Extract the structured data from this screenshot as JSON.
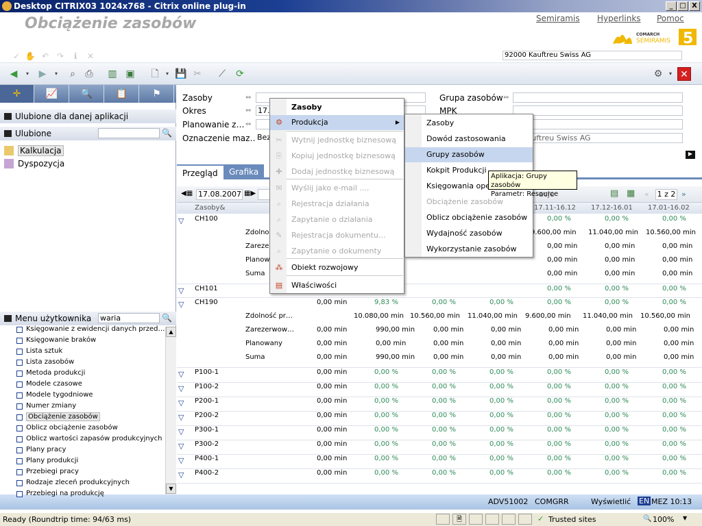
{
  "window": {
    "title": "Desktop CITRIX03 1024x768 - Citrix online plug-in",
    "min": "_",
    "max": "□",
    "close": "X"
  },
  "header": {
    "title": "Obciążenie zasobów",
    "links": [
      "Semiramis",
      "Hyperlinks",
      "Pomoc"
    ],
    "logo": {
      "brand_top": "COMARCH",
      "brand": "SEMIRAMIS",
      "version": "5"
    },
    "company": "92000 Kauftreu Swiss AG"
  },
  "left": {
    "favorites_app_header": "Ulubione dla danej aplikacji",
    "favorites_header": "Ulubione",
    "favorites": [
      "Kalkulacja",
      "Dyspozycja"
    ],
    "user_menu_header": "Menu użytkownika",
    "user_menu_search": "waria",
    "menu_items": [
      "Księgowanie z ewidencji danych przed…",
      "Księgowanie braków",
      "Lista sztuk",
      "Lista zasobów",
      "Metoda produkcji",
      "Modele czasowe",
      "Modele tygodniowe",
      "Numer zmiany",
      "Obciążenie zasobów",
      "Oblicz obciążenie zasobów",
      "Oblicz wartości zapasów produkcyjnych",
      "Plany pracy",
      "Plany produkcji",
      "Przebiegi pracy",
      "Rodzaje zleceń produkcyjnych",
      "Przebiegi na produkcję"
    ]
  },
  "form": {
    "zasoby": "Zasoby",
    "okres": "Okres",
    "okres_value": "17.",
    "planowanie": "Planowanie z…",
    "oznaczenie": "Oznaczenie maz…",
    "oznaczenie_value": "Bez",
    "grupa": "Grupa zasobów",
    "mpk": "MPK",
    "company_value": "0 Kauftreu Swiss AG"
  },
  "tabs": [
    "Przegląd",
    "Grafika"
  ],
  "gridbar": {
    "date": "17.08.2007",
    "pager": "1 z 2",
    "header_partial": "acje"
  },
  "grid": {
    "col_header": "Zasoby&",
    "periods": [
      "17.11-16.12",
      "17.12-16.01",
      "17.01-16.02"
    ],
    "rows": [
      {
        "name": "CH100",
        "vals": [
          "0,00 %",
          "0,00 %",
          "0,00 %"
        ]
      },
      {
        "sub": "Zdolnoś",
        "vals": [
          "9.600,00 min",
          "11.040,00 min",
          "10.560,00 min"
        ]
      },
      {
        "sub": "Zarezer",
        "vals": [
          "0,00 min",
          "0,00 min",
          "0,00 min"
        ]
      },
      {
        "sub": "Planow",
        "vals": [
          "0,00 min",
          "0,00 min",
          "0,00 min"
        ]
      },
      {
        "sub": "Suma",
        "vals": [
          "0,00 min",
          "0,00 min",
          "0,00 min"
        ]
      },
      {
        "name": "CH101",
        "vals": [
          "0,00 %",
          "0,00 %",
          "0,00 %"
        ]
      },
      {
        "name": "CH190",
        "c1": "0,00 min",
        "c2": "9,83 %",
        "vals": [
          "0,00 %",
          "0,00 %",
          "0,00 %"
        ],
        "extra": [
          "0,00 %",
          "0,00 %"
        ]
      }
    ],
    "ch190_sub": [
      {
        "sub": "Zdolność pr…",
        "c2": "10.080,00 min",
        "v": [
          "10.560,00 min",
          "11.040,00 min",
          "9.600,00 min",
          "11.040,00 min",
          "10.560,00 min"
        ]
      },
      {
        "sub": "Zarezerwow…",
        "c1": "0,00 min",
        "c2": "990,00 min",
        "v": [
          "0,00 min",
          "0,00 min",
          "0,00 min",
          "0,00 min",
          "0,00 min"
        ]
      },
      {
        "sub": "Planowany",
        "c1": "0,00 min",
        "c2": "0,00 min",
        "v": [
          "0,00 min",
          "0,00 min",
          "0,00 min",
          "0,00 min",
          "0,00 min"
        ]
      },
      {
        "sub": "Suma",
        "c1": "0,00 min",
        "c2": "990,00 min",
        "v": [
          "0,00 min",
          "0,00 min",
          "0,00 min",
          "0,00 min",
          "0,00 min"
        ]
      }
    ],
    "bottom_rows": [
      "P100-1",
      "P100-2",
      "P200-1",
      "P200-2",
      "P300-1",
      "P300-2",
      "P400-1",
      "P400-2"
    ],
    "bottom_c1": "0,00 min",
    "bottom_pct": "0,00 %",
    "upper_min": "0,00 min",
    "upper_pct": "0,00 %",
    "ch101_c1": "0,00 min"
  },
  "context_menu": {
    "header": "Zasoby",
    "items": [
      {
        "label": "Produkcja",
        "state": "highlight",
        "submenu": true
      },
      {
        "label": "Wytnij jednostkę biznesową",
        "state": "disabled"
      },
      {
        "label": "Kopiuj jednostkę biznesową",
        "state": "disabled"
      },
      {
        "label": "Dodaj jednostkę biznesową",
        "state": "disabled"
      },
      {
        "label": "Wyślij jako e-mail ....",
        "state": "disabled"
      },
      {
        "label": "Rejestracja działania",
        "state": "disabled"
      },
      {
        "label": "Zapytanie o działania",
        "state": "disabled"
      },
      {
        "label": "Rejestracja dokumentu...",
        "state": "disabled"
      },
      {
        "label": "Zapytanie o dokumenty",
        "state": "disabled"
      },
      {
        "label": "Obiekt rozwojowy",
        "state": "normal"
      },
      {
        "label": "Właściwości",
        "state": "normal"
      }
    ]
  },
  "submenu": {
    "items": [
      {
        "label": "Zasoby",
        "state": "normal"
      },
      {
        "label": "Dowód zastosowania",
        "state": "normal"
      },
      {
        "label": "Grupy zasobów",
        "state": "highlight"
      },
      {
        "label": "Kokpit Produkcji",
        "state": "normal"
      },
      {
        "label": "Księgowania ope",
        "state": "normal"
      },
      {
        "label": "Obciążenie zasobów",
        "state": "disabled"
      },
      {
        "label": "Oblicz obciążenie zasobów",
        "state": "normal"
      },
      {
        "label": "Wydajność zasobów",
        "state": "normal"
      },
      {
        "label": "Wykorzystanie zasobów",
        "state": "normal"
      }
    ]
  },
  "tooltip": {
    "line1": "Aplikacja: Grupy zasobów",
    "line2": "Parametr: Resource"
  },
  "status_app": {
    "code": "ADV51002",
    "user": "COMGRR",
    "action": "Wyświetlić",
    "lang": "EN",
    "time": "MEZ 10:13"
  },
  "status_ie": {
    "ready": "Ready (Roundtrip time: 94/63 ms)",
    "zone": "Trusted sites",
    "zoom": "100%"
  }
}
